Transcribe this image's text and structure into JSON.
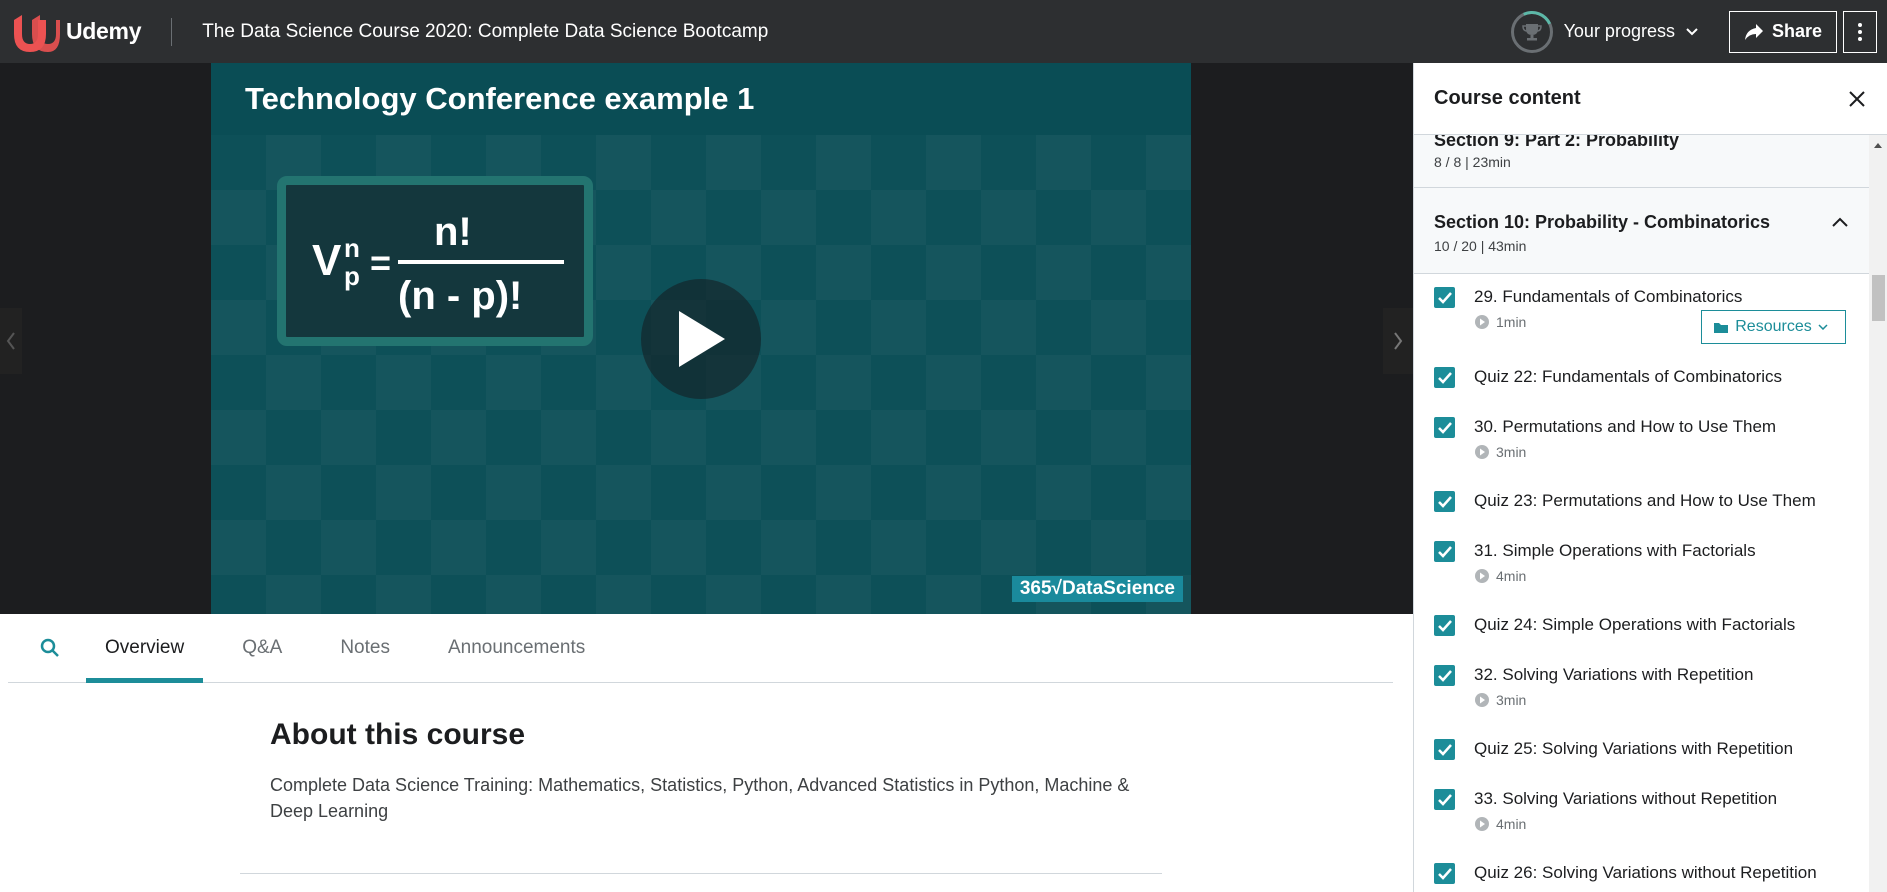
{
  "header": {
    "brand": "Udemy",
    "course_title": "The Data Science Course 2020: Complete Data Science Bootcamp",
    "progress_label": "Your progress",
    "share_label": "Share"
  },
  "video": {
    "slide_title": "Technology Conference example 1",
    "brand_label": "365√DataScience"
  },
  "tabs": [
    {
      "label": "Overview",
      "active": true
    },
    {
      "label": "Q&A"
    },
    {
      "label": "Notes"
    },
    {
      "label": "Announcements"
    }
  ],
  "about": {
    "title": "About this course",
    "description": "Complete Data Science Training: Mathematics, Statistics, Python, Advanced Statistics in Python, Machine & Deep Learning"
  },
  "sidebar": {
    "title": "Course content",
    "prev_section": {
      "title": "Section 9: Part 2: Probability",
      "meta": "8 / 8 | 23min"
    },
    "current_section": {
      "title": "Section 10: Probability - Combinatorics",
      "meta": "10 / 20 | 43min"
    },
    "resources_label": "Resources",
    "lectures": [
      {
        "title": "29. Fundamentals of Combinatorics",
        "duration": "1min"
      },
      {
        "title": "Quiz 22: Fundamentals of Combinatorics"
      },
      {
        "title": "30. Permutations and How to Use Them",
        "duration": "3min"
      },
      {
        "title": "Quiz 23: Permutations and How to Use Them"
      },
      {
        "title": "31. Simple Operations with Factorials",
        "duration": "4min"
      },
      {
        "title": "Quiz 24: Simple Operations with Factorials"
      },
      {
        "title": "32. Solving Variations with Repetition",
        "duration": "3min"
      },
      {
        "title": "Quiz 25: Solving Variations with Repetition"
      },
      {
        "title": "33. Solving Variations without Repetition",
        "duration": "4min"
      },
      {
        "title": "Quiz 26: Solving Variations without Repetition"
      }
    ]
  },
  "colors": {
    "accent": "#1c8d99",
    "header_bg": "#2d2f31",
    "brand_red": "#ec5252"
  }
}
